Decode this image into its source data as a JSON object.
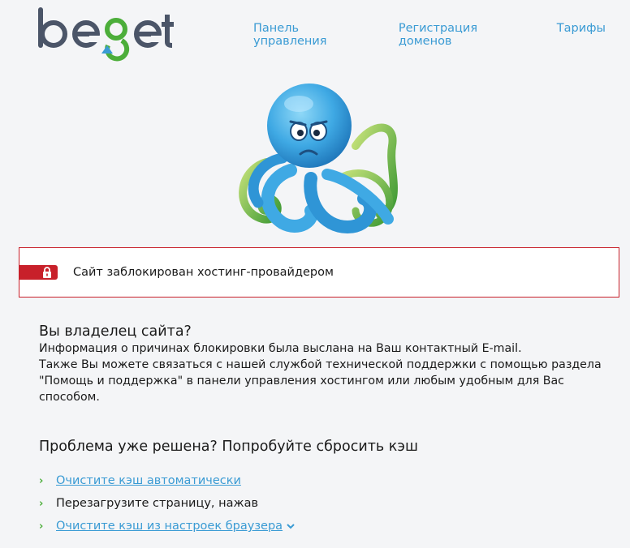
{
  "header": {
    "logo_text": "beget",
    "nav": [
      {
        "label": "Панель управления"
      },
      {
        "label": "Регистрация доменов"
      },
      {
        "label": "Тарифы"
      }
    ]
  },
  "alert": {
    "message": "Сайт заблокирован хостинг-провайдером",
    "icon": "lock-icon"
  },
  "owner": {
    "title": "Вы владелец сайта?",
    "line1": "Информация о причинах блокировки была выслана на Ваш контактный E-mail.",
    "line2": "Также Вы можете связаться с нашей службой технической поддержки с помощью раздела",
    "line3": "\"Помощь и поддержка\" в панели управления хостингом или любым удобным для Вас способом."
  },
  "cache": {
    "title": "Проблема уже решена? Попробуйте сбросить кэш",
    "items": [
      {
        "label": "Очистите кэш автоматически"
      },
      {
        "label": "Перезагрузите страницу, нажав"
      },
      {
        "label": "Очистите кэш из настроек браузера"
      }
    ]
  },
  "colors": {
    "accent": "#3a9bd4",
    "alert": "#c8202a",
    "chevron": "#4cae3a"
  }
}
